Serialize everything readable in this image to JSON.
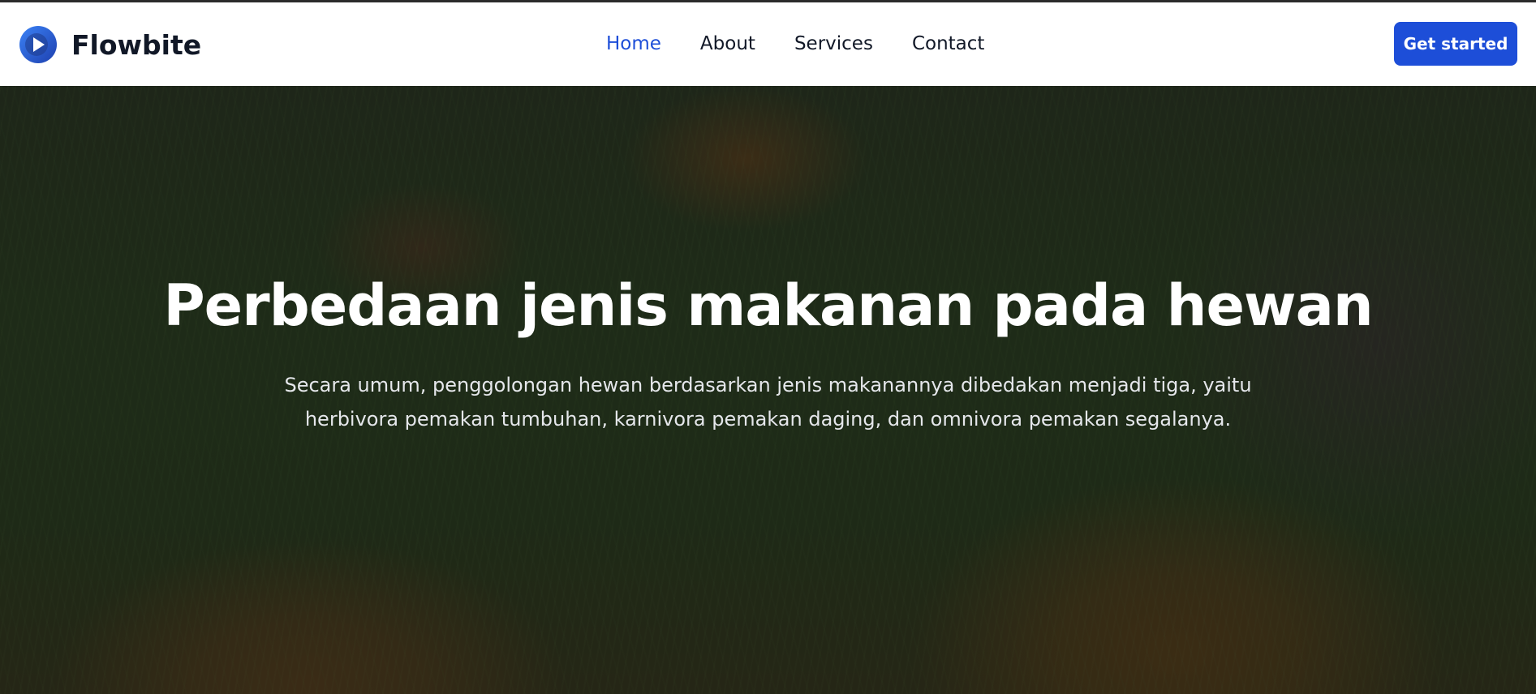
{
  "brand": {
    "name": "Flowbite",
    "logo_icon": "play-circle-icon",
    "logo_color": "#1d4ed8"
  },
  "nav": {
    "items": [
      {
        "label": "Home",
        "active": true
      },
      {
        "label": "About",
        "active": false
      },
      {
        "label": "Services",
        "active": false
      },
      {
        "label": "Contact",
        "active": false
      }
    ],
    "active_color": "#1d4ed8"
  },
  "cta": {
    "label": "Get started",
    "color": "#1d4ed8"
  },
  "hero": {
    "title": "Perbedaan jenis makanan pada hewan",
    "subtitle": "Secara umum, penggolongan hewan berdasarkan jenis makanannya dibedakan menjadi tiga, yaitu herbivora pemakan tumbuhan, karnivora pemakan daging, dan omnivora pemakan segalanya."
  }
}
